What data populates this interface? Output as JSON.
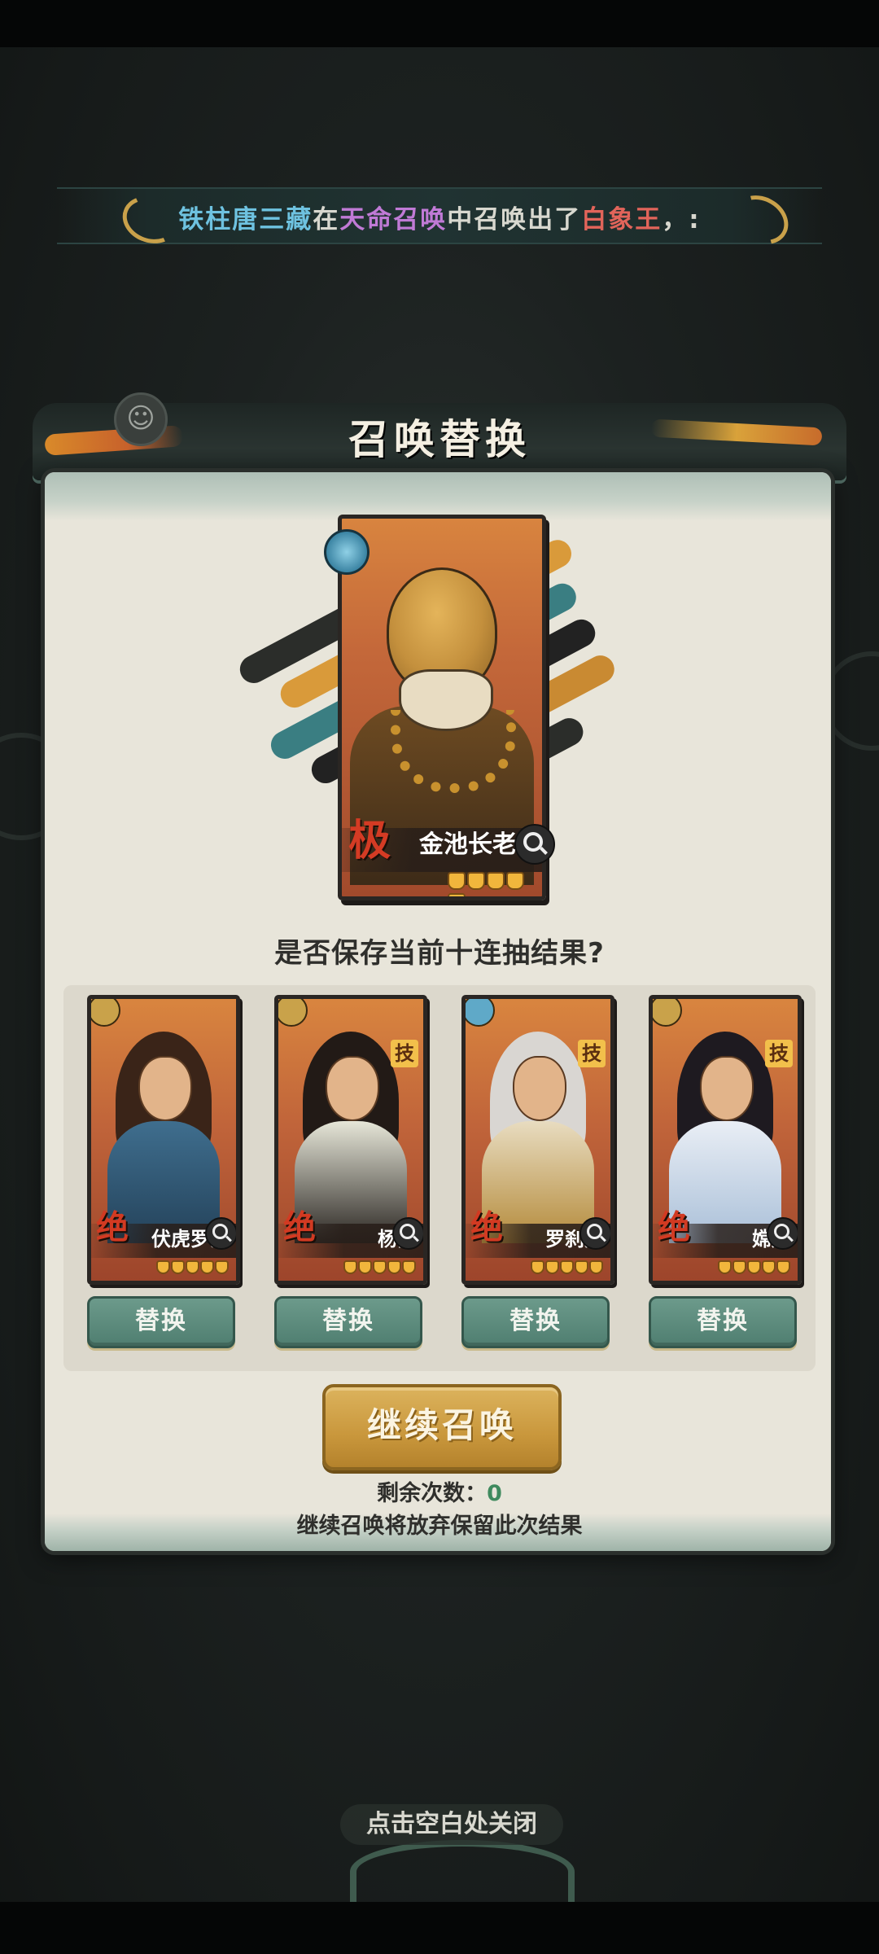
{
  "broadcast": {
    "player": "铁柱唐三藏",
    "t1": "在",
    "event": "天命召唤",
    "t2": "中召唤出了",
    "hero": "白象王",
    "t3": "，:"
  },
  "dialog": {
    "title": "召唤替换",
    "question": "是否保存当前十连抽结果?",
    "featured": {
      "grade": "极",
      "name": "金池长老",
      "stars": 5,
      "faction_icon": "water-drop-faction-icon"
    },
    "roster": [
      {
        "name": "伏虎罗汉",
        "grade": "绝",
        "tag": "",
        "stars": 5,
        "replace_label": "替换",
        "badge_color": "#c9a24a"
      },
      {
        "name": "杨戬",
        "grade": "绝",
        "tag": "技",
        "stars": 5,
        "replace_label": "替换",
        "badge_color": "#c9a24a"
      },
      {
        "name": "罗刹女",
        "grade": "绝",
        "tag": "技",
        "stars": 5,
        "replace_label": "替换",
        "badge_color": "#5fa9c8"
      },
      {
        "name": "嫦娥",
        "grade": "绝",
        "tag": "技",
        "stars": 5,
        "replace_label": "替换",
        "badge_color": "#c9a24a"
      }
    ],
    "continue_label": "继续召唤",
    "remaining_label": "剩余次数：",
    "remaining_value": "0",
    "warning": "继续召唤将放弃保留此次结果"
  },
  "close_hint": "点击空白处关闭",
  "colors": {
    "panel": "#e8e5da",
    "card_orange": "#c4683a",
    "replace_green": "#5b8a7b",
    "continue_gold": "#c9973c",
    "grade_red": "#d43b24"
  }
}
